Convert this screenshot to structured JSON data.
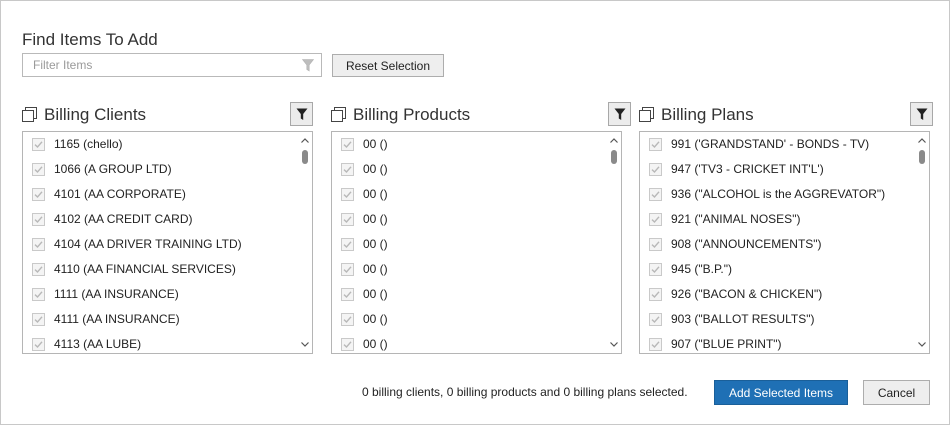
{
  "dialog": {
    "title": "Find Items To Add",
    "filter": {
      "placeholder": "Filter Items",
      "value": ""
    },
    "reset_label": "Reset Selection",
    "status": "0 billing clients, 0 billing products and 0 billing plans selected.",
    "add_label": "Add Selected Items",
    "cancel_label": "Cancel"
  },
  "panels": [
    {
      "title": "Billing Clients",
      "items": [
        "1165 (chello)",
        "1066 (A GROUP LTD)",
        "4101 (AA CORPORATE)",
        "4102 (AA CREDIT CARD)",
        "4104 (AA DRIVER TRAINING LTD)",
        "4110 (AA FINANCIAL SERVICES)",
        "1111 (AA INSURANCE)",
        "4111 (AA INSURANCE)",
        "4113 (AA LUBE)"
      ]
    },
    {
      "title": "Billing Products",
      "items": [
        "00 ()",
        "00 ()",
        "00 ()",
        "00 ()",
        "00 ()",
        "00 ()",
        "00 ()",
        "00 ()",
        "00 ()"
      ]
    },
    {
      "title": "Billing Plans",
      "items": [
        "991 ('GRANDSTAND' - BONDS - TV)",
        "947 ('TV3 - CRICKET INT'L')",
        "936 (\"ALCOHOL is the AGGREVATOR\")",
        "921 (\"ANIMAL NOSES\")",
        "908 (\"ANNOUNCEMENTS\")",
        "945 (\"B.P.\")",
        "926 (\"BACON & CHICKEN\")",
        "903 (\"BALLOT RESULTS\")",
        "907 (\"BLUE PRINT\")"
      ]
    }
  ],
  "icons": {
    "filter": "funnel-icon",
    "panel": "copy-icon",
    "check": "check-icon",
    "scroll_up": "chevron-up-icon",
    "scroll_down": "chevron-down-icon"
  },
  "colors": {
    "primary": "#1f70b5",
    "check": "#b8b8b8"
  }
}
